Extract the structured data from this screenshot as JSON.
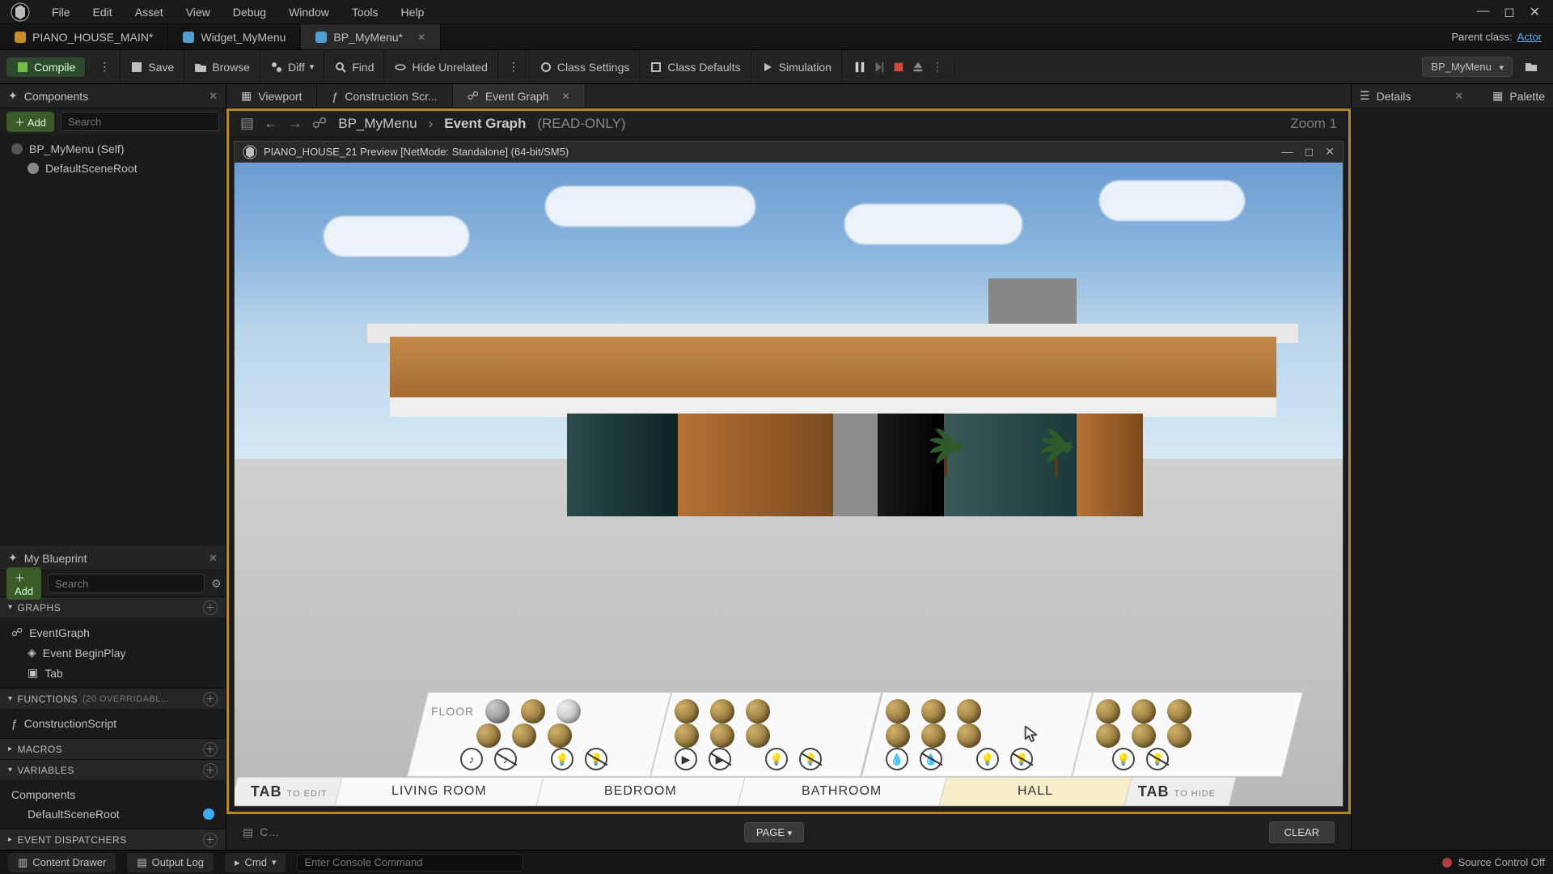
{
  "menu": {
    "items": [
      "File",
      "Edit",
      "Asset",
      "View",
      "Debug",
      "Window",
      "Tools",
      "Help"
    ]
  },
  "doc_tabs": {
    "items": [
      {
        "icon": "orange",
        "label": "PIANO_HOUSE_MAIN*",
        "active": false
      },
      {
        "icon": "blue",
        "label": "Widget_MyMenu",
        "active": false
      },
      {
        "icon": "blue",
        "label": "BP_MyMenu*",
        "active": true,
        "closeable": true
      }
    ],
    "parent_class_label": "Parent class:",
    "parent_class_link": "Actor"
  },
  "toolbar": {
    "compile": "Compile",
    "save": "Save",
    "browse": "Browse",
    "diff": "Diff",
    "find": "Find",
    "hide_unrelated": "Hide Unrelated",
    "class_settings": "Class Settings",
    "class_defaults": "Class Defaults",
    "simulation": "Simulation",
    "play_dropdown": "BP_MyMenu"
  },
  "components": {
    "title": "Components",
    "add": "Add",
    "search_placeholder": "Search",
    "tree": [
      {
        "label": "BP_MyMenu (Self)",
        "indent": 0
      },
      {
        "label": "DefaultSceneRoot",
        "indent": 1
      }
    ]
  },
  "myblueprint": {
    "title": "My Blueprint",
    "add": "Add",
    "search_placeholder": "Search",
    "sections": {
      "graphs": {
        "title": "GRAPHS",
        "items": [
          "EventGraph",
          "Event BeginPlay",
          "Tab"
        ]
      },
      "functions": {
        "title": "FUNCTIONS",
        "subtitle": "(20 OVERRIDABL...",
        "items": [
          "ConstructionScript"
        ]
      },
      "macros": {
        "title": "MACROS",
        "items": []
      },
      "variables": {
        "title": "VARIABLES",
        "components_label": "Components",
        "items": [
          "DefaultSceneRoot"
        ]
      },
      "dispatchers": {
        "title": "EVENT DISPATCHERS",
        "items": []
      }
    }
  },
  "graph_tabs": {
    "items": [
      {
        "label": "Viewport",
        "icon": "viewport-icon"
      },
      {
        "label": "Construction Scr...",
        "icon": "function-icon"
      },
      {
        "label": "Event Graph",
        "icon": "graph-icon",
        "active": true,
        "closeable": true
      }
    ]
  },
  "breadcrumb": {
    "root": "BP_MyMenu",
    "leaf": "Event Graph",
    "readonly": "(READ-ONLY)",
    "zoom": "Zoom 1"
  },
  "preview": {
    "title": "PIANO_HOUSE_21 Preview [NetMode: Standalone]  (64-bit/SM5)",
    "rooms": {
      "tab_left_big": "TAB",
      "tab_left_small": "TO EDIT",
      "tab_right_big": "TAB",
      "tab_right_small": "TO HIDE",
      "list": [
        {
          "label": "LIVING ROOM"
        },
        {
          "label": "BEDROOM"
        },
        {
          "label": "BATHROOM"
        },
        {
          "label": "HALL",
          "highlight": true
        }
      ]
    },
    "floor_label": "FLOOR"
  },
  "center_footer": {
    "page": "PAGE",
    "clear": "CLEAR"
  },
  "right_panels": {
    "details": "Details",
    "palette": "Palette"
  },
  "bottom": {
    "content_drawer": "Content Drawer",
    "output_log": "Output Log",
    "cmd": "Cmd",
    "cmd_placeholder": "Enter Console Command",
    "source_control": "Source Control Off"
  }
}
